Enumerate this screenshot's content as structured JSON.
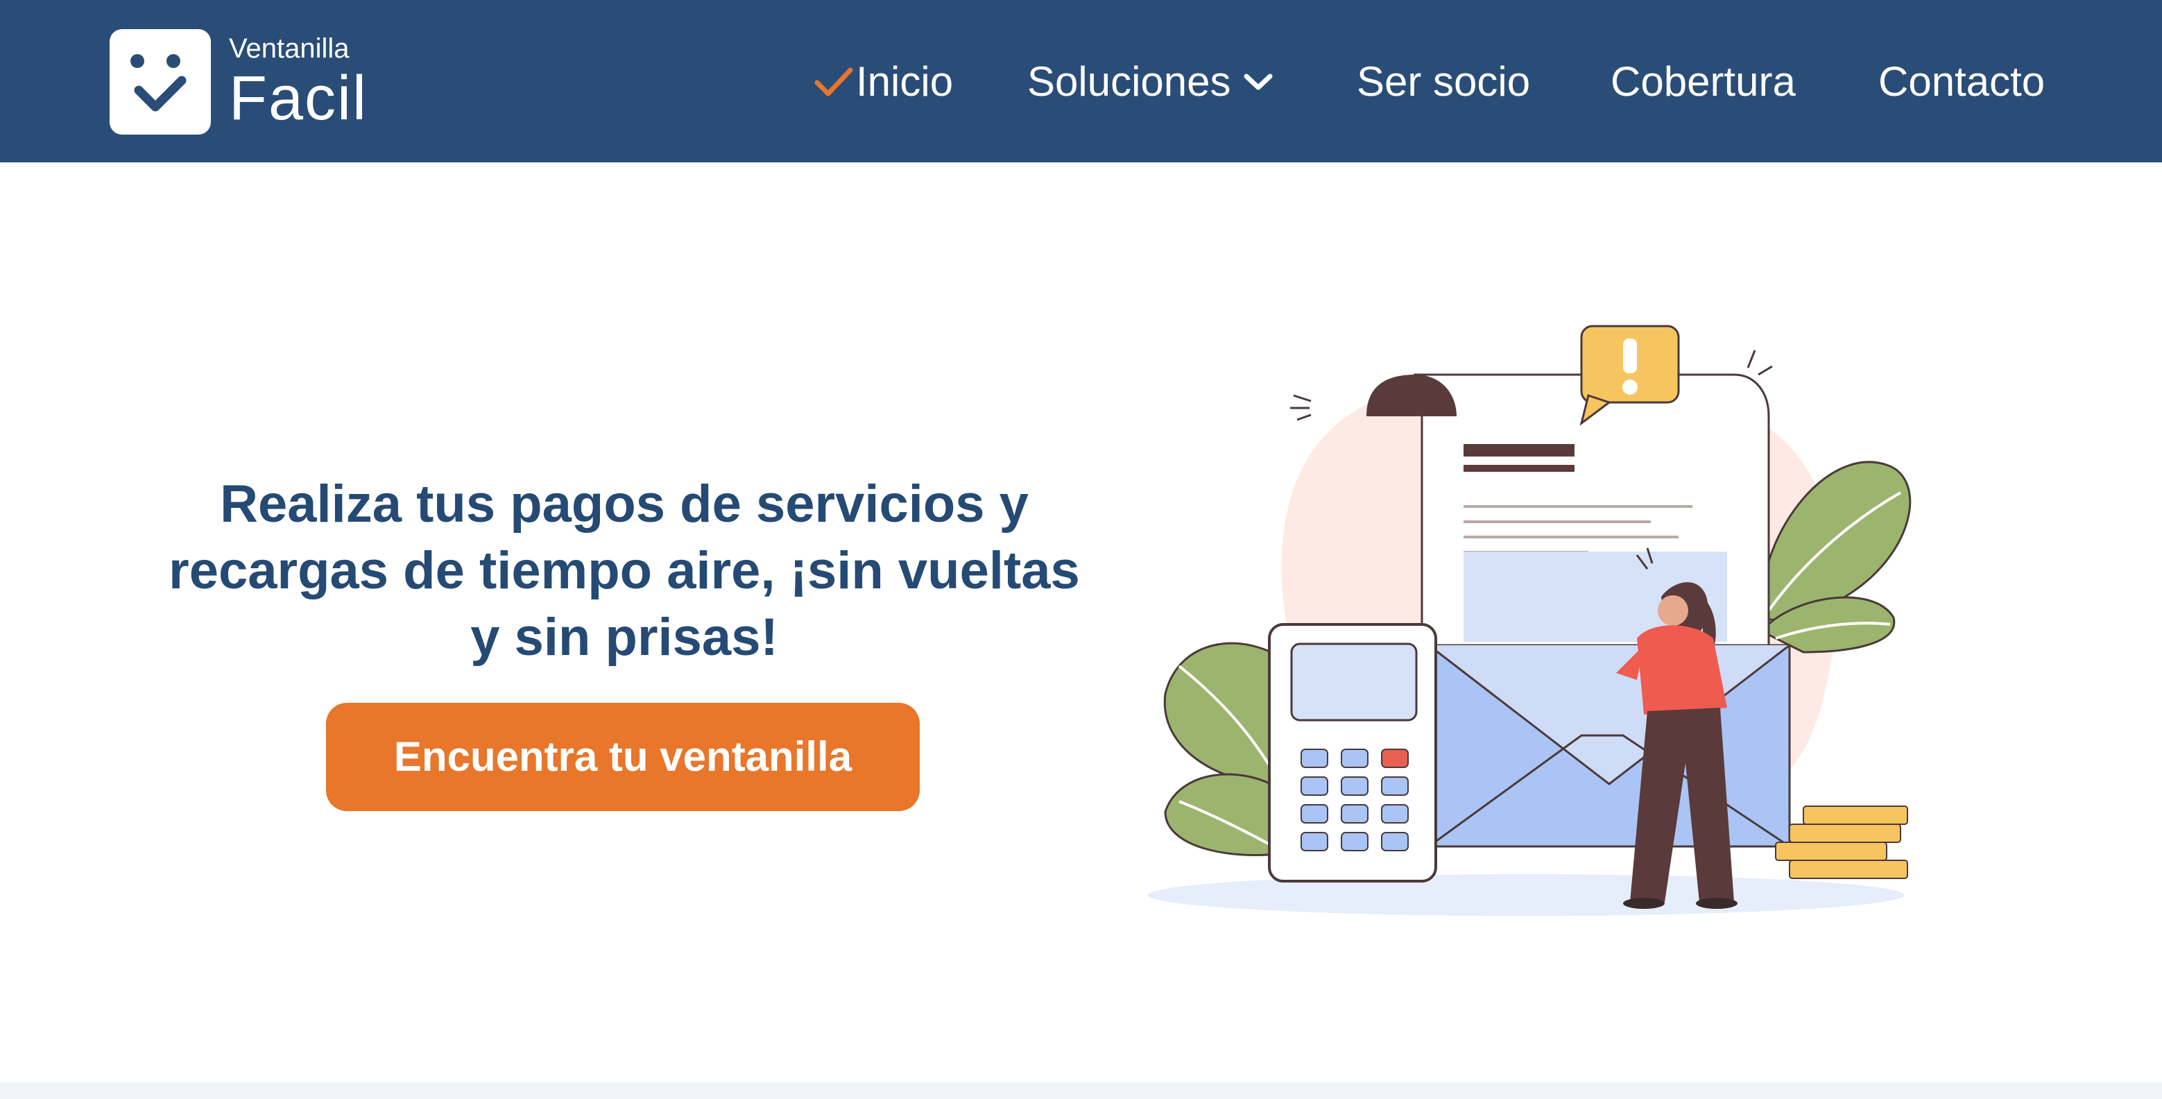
{
  "brand": {
    "name_small": "Ventanilla",
    "name_big": "Facil"
  },
  "nav": {
    "items": [
      {
        "label": "Inicio",
        "active": true,
        "icon": "check-icon"
      },
      {
        "label": "Soluciones",
        "icon": "chevron-down-icon"
      },
      {
        "label": "Ser socio"
      },
      {
        "label": "Cobertura"
      },
      {
        "label": "Contacto"
      }
    ]
  },
  "hero": {
    "title": "Realiza tus pagos de servicios y recargas de tiempo aire, ¡sin vueltas y sin prisas!",
    "cta_label": "Encuentra tu ventanilla"
  },
  "colors": {
    "navbar": "#2a4d77",
    "accent": "#e8762b",
    "title": "#254a74",
    "white": "#ffffff"
  }
}
